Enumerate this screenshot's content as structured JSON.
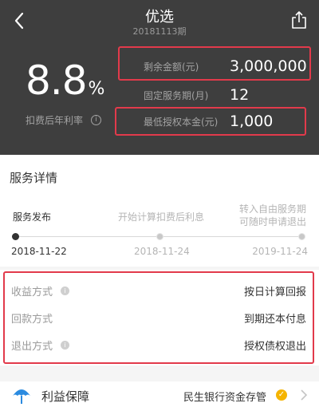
{
  "header": {
    "title": "优选",
    "subtitle": "20181113期",
    "back_icon": "chevron-left-icon",
    "share_icon": "share-icon"
  },
  "summary": {
    "rate_value": "8.8",
    "rate_unit": "%",
    "rate_label": "扣费后年利率",
    "remaining_label": "剩余金额(元)",
    "remaining_value": "3,000,000",
    "term_label": "固定服务期(月)",
    "term_value": "12",
    "min_label": "最低授权本金(元)",
    "min_value": "1,000"
  },
  "service": {
    "title": "服务详情",
    "steps": [
      {
        "label": "服务发布",
        "date": "2018-11-22"
      },
      {
        "label": "开始计算扣费后利息",
        "date": "2018-11-24"
      },
      {
        "label_line1": "转入自由服务期",
        "label_line2": "可随时申请退出",
        "date": "2019-11-24"
      }
    ]
  },
  "details": [
    {
      "key": "收益方式",
      "value": "按日计算回报",
      "has_info": true
    },
    {
      "key": "回款方式",
      "value": "到期还本付息",
      "has_info": false
    },
    {
      "key": "退出方式",
      "value": "授权债权退出",
      "has_info": true
    }
  ],
  "footer": {
    "title": "利益保障",
    "value": "民生银行资金存管"
  },
  "colors": {
    "highlight": "#e23a4b",
    "hero_bg": "#3e3e3e",
    "badge": "#f5b400"
  }
}
